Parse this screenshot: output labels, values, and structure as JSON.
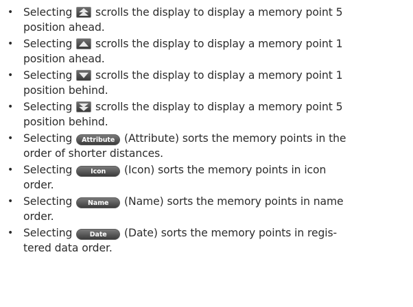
{
  "items": [
    {
      "pre": "Selecting",
      "post": "scrolls the display to display a memory point 5",
      "cont": "position ahead."
    },
    {
      "pre": "Selecting",
      "post": "scrolls the display to display a memory point 1",
      "cont": "position ahead."
    },
    {
      "pre": "Selecting",
      "post": "scrolls the display to display a memory point 1",
      "cont": "position behind."
    },
    {
      "pre": "Selecting",
      "post": "scrolls the display to display a memory point 5",
      "cont": "position behind."
    },
    {
      "pre": "Selecting",
      "button": "Attribute",
      "post": "(Attribute) sorts the memory points in the",
      "cont": "order of shorter distances."
    },
    {
      "pre": "Selecting",
      "button": "Icon",
      "post": "(Icon) sorts the memory points in icon",
      "cont": "order."
    },
    {
      "pre": "Selecting",
      "button": "Name",
      "post": "(Name) sorts the memory points in name",
      "cont": "order."
    },
    {
      "pre": "Selecting",
      "button": "Date",
      "post": "(Date) sorts the memory points in regis-",
      "cont": "tered data order."
    }
  ],
  "icons": [
    "scroll-up-5-icon",
    "scroll-up-1-icon",
    "scroll-down-1-icon",
    "scroll-down-5-icon"
  ],
  "colors": {
    "text": "#2b2b2b",
    "button_bg": "#4a4a4a",
    "button_text": "#ffffff",
    "arrow": "#e8e8e8"
  }
}
